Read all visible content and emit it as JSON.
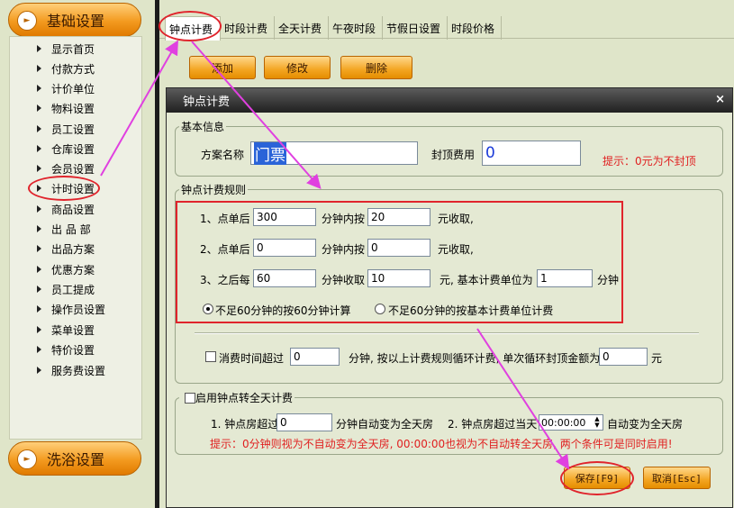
{
  "sidebar": {
    "section_top": "基础设置",
    "section_bottom": "洗浴设置",
    "items": [
      "显示首页",
      "付款方式",
      "计价单位",
      "物料设置",
      "员工设置",
      "仓库设置",
      "会员设置",
      "计时设置",
      "商品设置",
      "出 品 部",
      "出品方案",
      "优惠方案",
      "员工提成",
      "操作员设置",
      "菜单设置",
      "特价设置",
      "服务费设置"
    ]
  },
  "tabs": [
    "钟点计费",
    "时段计费",
    "全天计费",
    "午夜时段",
    "节假日设置",
    "时段价格"
  ],
  "toolbar": {
    "add": "添加",
    "edit": "修改",
    "delete": "删除"
  },
  "dialog": {
    "title": "钟点计费",
    "close": "×",
    "basic": {
      "legend": "基本信息",
      "plan_name_label": "方案名称",
      "plan_name_value": "门票",
      "cap_fee_label": "封顶费用",
      "cap_fee_value": "0",
      "hint": "提示：0元为不封顶"
    },
    "rules": {
      "legend": "钟点计费规则",
      "r1_prefix": "1、点单后",
      "r1_minutes": "300",
      "r1_mid": "分钟内按",
      "r1_amount": "20",
      "r1_suffix": "元收取,",
      "r2_prefix": "2、点单后",
      "r2_minutes": "0",
      "r2_mid": "分钟内按",
      "r2_amount": "0",
      "r2_suffix": "元收取,",
      "r3_prefix": "3、之后每",
      "r3_minutes": "60",
      "r3_mid": "分钟收取",
      "r3_amount": "10",
      "r3_suffix": "元, 基本计费单位为",
      "r3_unit": "1",
      "r3_unit_suffix": "分钟",
      "radio1": "不足60分钟的按60分钟计算",
      "radio2": "不足60分钟的按基本计费单位计费",
      "consume_label": "消费时间超过",
      "consume_value": "0",
      "consume_mid": "分钟, 按以上计费规则循环计费, 单次循环封顶金额为",
      "consume_cap": "0",
      "consume_suffix": "元"
    },
    "fullday": {
      "legend": "启用钟点转全天计费",
      "c1_label": "1. 钟点房超过",
      "c1_value": "0",
      "c1_suffix": "分钟自动变为全天房",
      "c2_label": "2. 钟点房超过当天",
      "c2_time": "00:00:00",
      "c2_suffix": "自动变为全天房",
      "note": "提示：0分钟则视为不自动变为全天房, 00:00:00也视为不自动转全天房, 两个条件可是同时启用!"
    },
    "save": "保存[F9]",
    "cancel": "取消[Esc]"
  },
  "colors": {
    "accent_orange": "#f3a522",
    "highlight_red": "#e0242c",
    "arrow_magenta": "#e040e0",
    "hint_red": "#e02020"
  }
}
